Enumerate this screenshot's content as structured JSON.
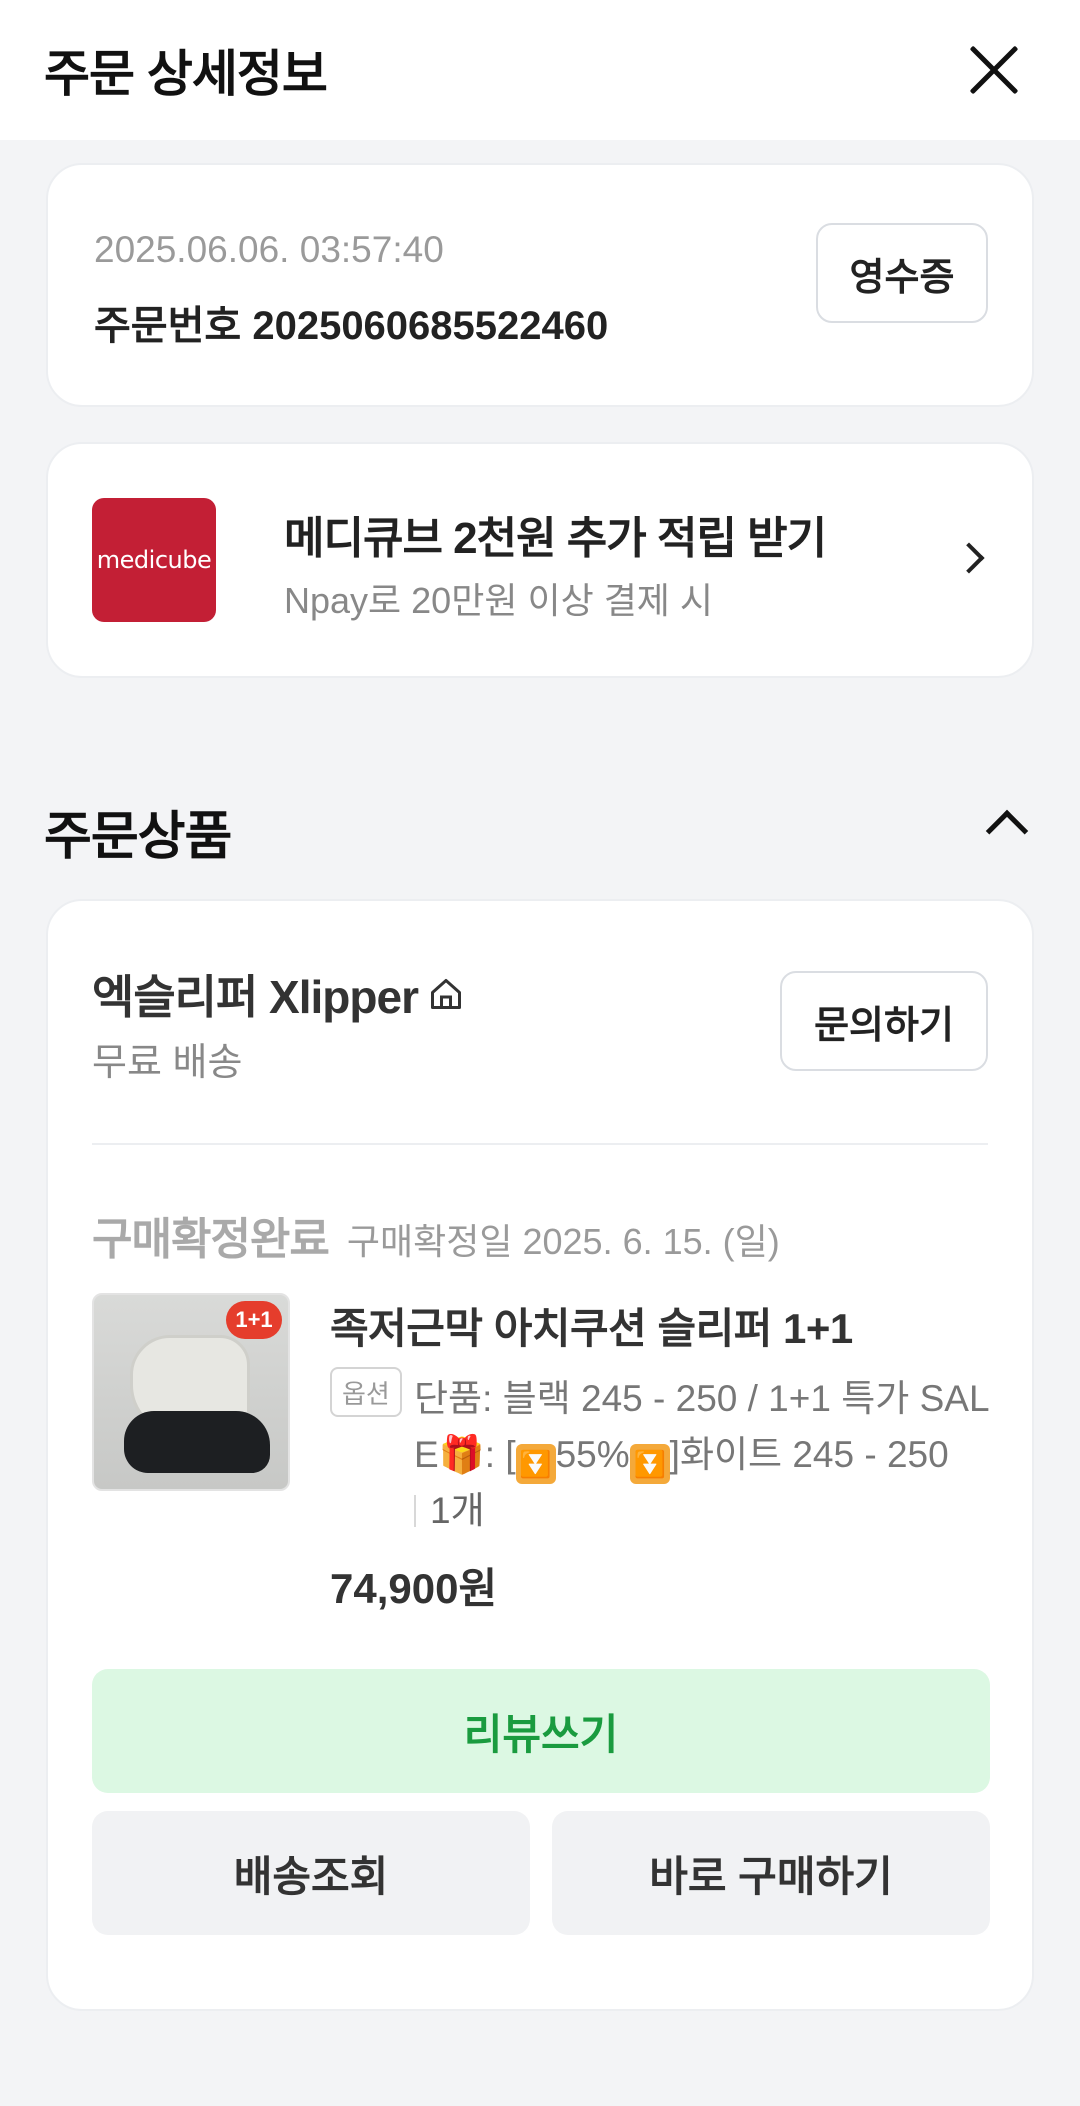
{
  "header": {
    "title": "주문 상세정보",
    "close_icon": "close-icon"
  },
  "order": {
    "datetime": "2025.06.06. 03:57:40",
    "number_label": "주문번호",
    "number": "2025060685522460",
    "receipt_label": "영수증"
  },
  "promo": {
    "brand": "medicube",
    "title": "메디큐브 2천원 추가 적립 받기",
    "subtitle": "Npay로 20만원 이상 결제 시",
    "brand_color": "#c31f35"
  },
  "section": {
    "title": "주문상품"
  },
  "product_card": {
    "store_name": "엑슬리퍼 Xlipper",
    "shipping": "무료 배송",
    "inquiry_label": "문의하기",
    "status": "구매확정완료",
    "confirm_date": "구매확정일 2025. 6. 15. (일)",
    "thumbnail_badge": "1+1",
    "product_name": "족저근막 아치쿠션 슬리퍼 1+1",
    "option_tag": "옵션",
    "option_text_1": "단품: 블랙 245 - 250 / 1+1 특가 SAL",
    "option_text_2_prefix": "E",
    "option_text_2_mid": ": [",
    "option_text_2_pct": "55%",
    "option_text_2_suffix": "]화이트 245 - 250",
    "quantity": "1개",
    "price": "74,900원",
    "review_label": "리뷰쓰기",
    "track_label": "배송조회",
    "rebuy_label": "바로 구매하기",
    "accent_green": "#1a9b3f"
  }
}
